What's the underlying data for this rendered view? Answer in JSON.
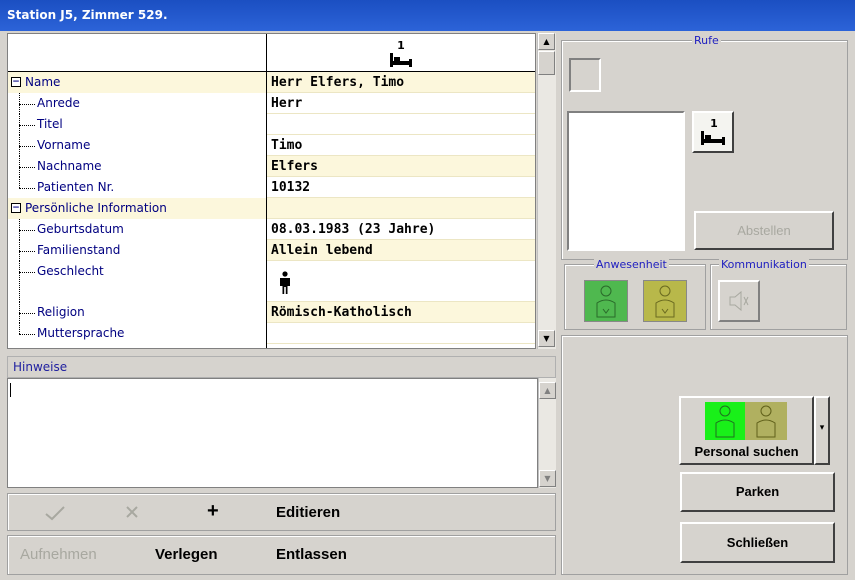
{
  "window": {
    "title": "Station J5, Zimmer 529."
  },
  "grid": {
    "header_bed_number": "1",
    "rows": [
      {
        "label": "Name",
        "value": "Herr Elfers, Timo",
        "level": 0,
        "expander": "−"
      },
      {
        "label": "Anrede",
        "value": "Herr",
        "level": 1
      },
      {
        "label": "Titel",
        "value": "",
        "level": 1
      },
      {
        "label": "Vorname",
        "value": "Timo",
        "level": 1
      },
      {
        "label": "Nachname",
        "value": "Elfers",
        "level": 1
      },
      {
        "label": "Patienten Nr.",
        "value": "10132",
        "level": 1
      },
      {
        "label": "Persönliche Information",
        "value": "",
        "level": 0,
        "expander": "−"
      },
      {
        "label": "Geburtsdatum",
        "value": "08.03.1983 (23 Jahre)",
        "level": 1
      },
      {
        "label": "Familienstand",
        "value": "Allein lebend",
        "level": 1
      },
      {
        "label": "Geschlecht",
        "value": "",
        "level": 1,
        "icon": "male-person-icon"
      },
      {
        "label": "Religion",
        "value": "Römisch-Katholisch",
        "level": 1
      },
      {
        "label": "Muttersprache",
        "value": "",
        "level": 1
      }
    ]
  },
  "notes": {
    "title": "Hinweise",
    "text": ""
  },
  "toolbar": {
    "confirm_icon": "check-icon",
    "cancel_icon": "cross-icon",
    "add_label": "+",
    "edit_label": "Editieren",
    "admit_label": "Aufnehmen",
    "move_label": "Verlegen",
    "discharge_label": "Entlassen"
  },
  "calls": {
    "title": "Rufe",
    "bed_number": "1",
    "stop_label": "Abstellen",
    "presence_title": "Anwesenheit",
    "communication_title": "Kommunikation"
  },
  "actions": {
    "search_staff_label": "Personal suchen",
    "park_label": "Parken",
    "close_label": "Schließen"
  },
  "colors": {
    "title_bar": "#2c63d8",
    "presence_green": "#4fb84f",
    "presence_olive": "#b8b84a",
    "search_green": "#19f019",
    "search_olive": "#b0b060",
    "label_text": "#000080",
    "row_highlight": "#fcf7dc"
  }
}
